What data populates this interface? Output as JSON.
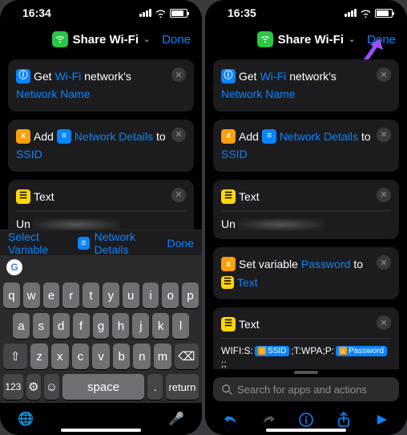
{
  "status": {
    "time": "16:34",
    "time2": "16:35"
  },
  "nav": {
    "title": "Share Wi-Fi",
    "done": "Done"
  },
  "actions": {
    "a1_get": "Get",
    "a1_wifi": "Wi-Fi",
    "a1_networks": "network's",
    "a1_netname": "Network Name",
    "a2_add": "Add",
    "a2_netdet": "Network Details",
    "a2_to": "to",
    "a2_ssid": "SSID",
    "a3_text": "Text",
    "a3_val": "Un",
    "a4_set": "Set variable",
    "a4_pwd": "Password",
    "a4_to": "to",
    "a4_txt": "Text",
    "a5_text": "Text",
    "wifi_pre": "WIFI:S:",
    "wifi_mid": ";T:WPA;P:",
    "wifi_end": ";;",
    "tag_ssid": "SSID",
    "tag_pwd": "Password"
  },
  "kb": {
    "select_var": "Select Variable",
    "net_det": "Network Details",
    "done": "Done",
    "k123": "123",
    "space": "space",
    "ret": "return",
    "rows": {
      "r1": [
        "q",
        "w",
        "e",
        "r",
        "t",
        "y",
        "u",
        "i",
        "o",
        "p"
      ],
      "r2": [
        "a",
        "s",
        "d",
        "f",
        "g",
        "h",
        "j",
        "k",
        "l"
      ],
      "r3": [
        "z",
        "x",
        "c",
        "v",
        "b",
        "n",
        "m"
      ]
    }
  },
  "search": {
    "placeholder": "Search for apps and actions"
  }
}
